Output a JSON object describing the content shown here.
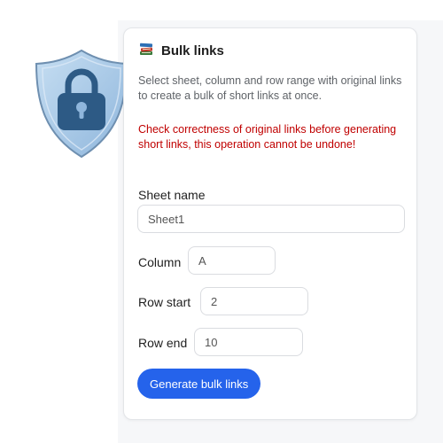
{
  "panel": {
    "title": "Bulk links",
    "title_icon": "books-icon",
    "description": "Select sheet, column and row range with original links to create a bulk of short links at once.",
    "warning": "Check correctness of original links before generating short links, this operation cannot be undone!"
  },
  "form": {
    "sheet_name": {
      "label": "Sheet name",
      "value": "Sheet1"
    },
    "column": {
      "label": "Column",
      "value": "A"
    },
    "row_start": {
      "label": "Row start",
      "value": "2"
    },
    "row_end": {
      "label": "Row end",
      "value": "10"
    },
    "submit_label": "Generate bulk links"
  },
  "colors": {
    "accent": "#2563eb",
    "warning": "#c00000",
    "shield": "#9fc3e5",
    "lock": "#2d5a85"
  },
  "icons": {
    "shield": "shield-lock-icon"
  }
}
